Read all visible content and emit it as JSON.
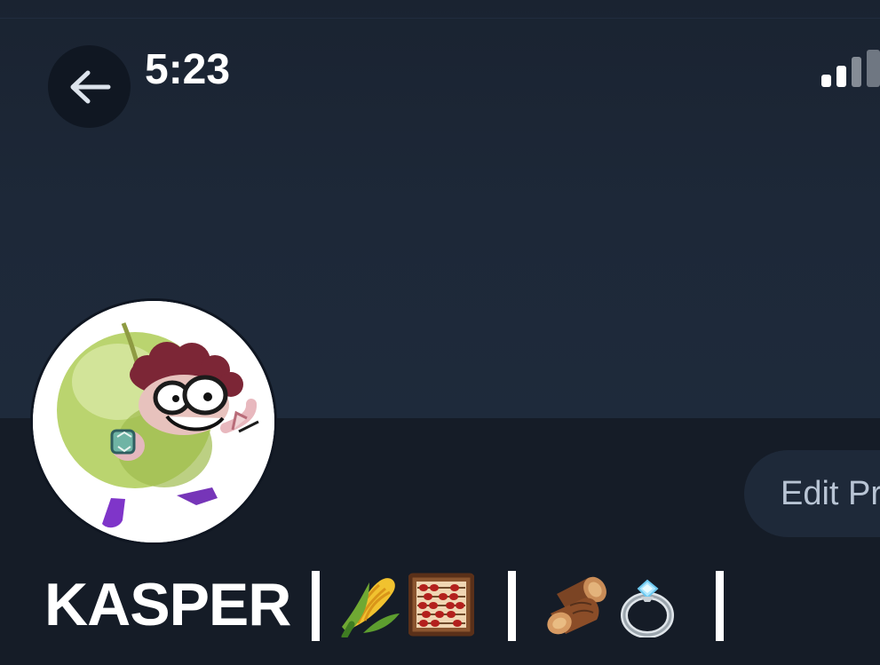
{
  "status_bar": {
    "time": "5:23",
    "signal_icon": "cellular-signal-icon"
  },
  "navigation": {
    "back_icon": "arrow-left-icon"
  },
  "profile": {
    "display_name": "KASPER",
    "edit_button_label": "Edit Pr",
    "emoji_icons": [
      "corn-icon",
      "abacus-icon",
      "wood-log-icon",
      "ring-icon"
    ]
  },
  "colors": {
    "background": "#151c27",
    "banner": "#1e2a3b",
    "button_background": "#1e2939",
    "text_primary": "#ffffff",
    "text_muted": "#b8c4d4"
  }
}
